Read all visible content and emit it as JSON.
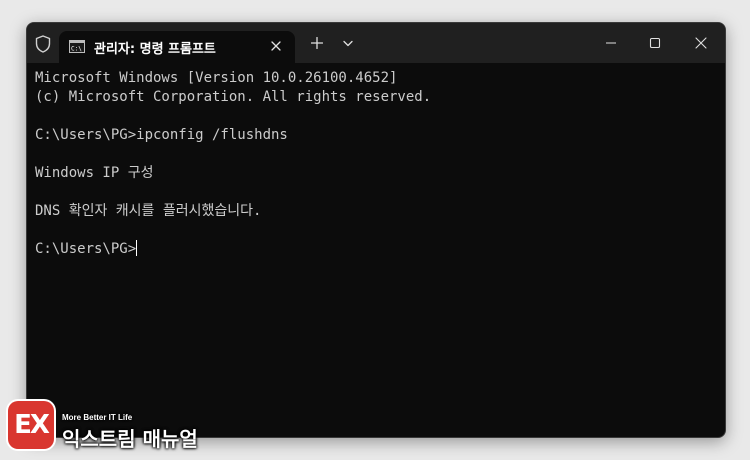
{
  "window": {
    "tab_title": "관리자: 명령 프롬프트"
  },
  "console": {
    "lines": [
      "Microsoft Windows [Version 10.0.26100.4652]",
      "(c) Microsoft Corporation. All rights reserved.",
      "",
      "C:\\Users\\PG>ipconfig /flushdns",
      "",
      "Windows IP 구성",
      "",
      "DNS 확인자 캐시를 플러시했습니다.",
      "",
      "C:\\Users\\PG>"
    ]
  },
  "icons": {
    "shield": "shield-icon",
    "tab": "cmd-icon",
    "tab_close": "close-icon",
    "new_tab": "plus-icon",
    "dropdown": "chevron-down-icon",
    "minimize": "minimize-icon",
    "maximize": "maximize-icon",
    "close": "close-icon"
  },
  "colors": {
    "console_bg": "#0c0c0c",
    "console_text": "#cccccc",
    "titlebar_bg": "#202020",
    "watermark_accent": "#d9362f"
  },
  "watermark": {
    "tagline": "More Better IT Life",
    "name": "익스트림 매뉴얼",
    "logo_text": "EX"
  }
}
